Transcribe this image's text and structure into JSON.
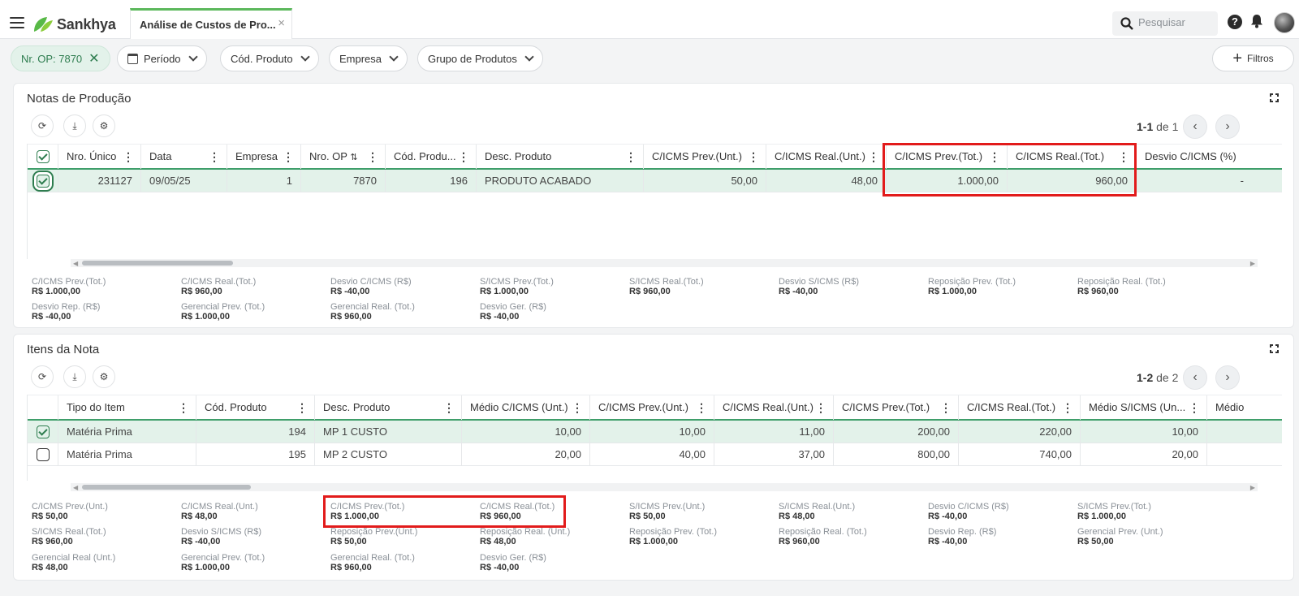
{
  "app": {
    "brand": "Sankhya",
    "tab_title": "Análise de Custos de Pro...",
    "tab_close": "×"
  },
  "search": {
    "placeholder": "Pesquisar"
  },
  "header_icons": {
    "help": "?"
  },
  "filters": [
    {
      "label": "Nr. OP: 7870",
      "active": true
    },
    {
      "label": "Período"
    },
    {
      "label": "Cód. Produto"
    },
    {
      "label": "Empresa"
    },
    {
      "label": "Grupo de Produtos"
    }
  ],
  "filtros_button": "Filtros",
  "notas": {
    "title": "Notas de Produção",
    "pager": {
      "range": "1-1",
      "of": "de 1"
    },
    "columns": [
      "Nro. Único",
      "Data",
      "Empresa",
      "Nro. OP",
      "Cód. Produ...",
      "Desc. Produto",
      "C/ICMS Prev.(Unt.)",
      "C/ICMS Real.(Unt.)",
      "C/ICMS Prev.(Tot.)",
      "C/ICMS Real.(Tot.)",
      "Desvio C/ICMS (%)"
    ],
    "rows": [
      [
        "231127",
        "09/05/25",
        "1",
        "7870",
        "196",
        "PRODUTO ACABADO",
        "50,00",
        "48,00",
        "1.000,00",
        "960,00",
        "-"
      ]
    ],
    "totals": [
      {
        "label": "C/ICMS Prev.(Tot.)",
        "value": "R$ 1.000,00"
      },
      {
        "label": "C/ICMS Real.(Tot.)",
        "value": "R$ 960,00"
      },
      {
        "label": "Desvio C/ICMS (R$)",
        "value": "R$ -40,00"
      },
      {
        "label": "S/ICMS Prev.(Tot.)",
        "value": "R$ 1.000,00"
      },
      {
        "label": "S/ICMS Real.(Tot.)",
        "value": "R$ 960,00"
      },
      {
        "label": "Desvio S/ICMS (R$)",
        "value": "R$ -40,00"
      },
      {
        "label": "Reposição Prev. (Tot.)",
        "value": "R$ 1.000,00"
      },
      {
        "label": "Reposição Real. (Tot.)",
        "value": "R$ 960,00"
      },
      {
        "label": "Desvio Rep. (R$)",
        "value": "R$ -40,00"
      },
      {
        "label": "Gerencial Prev. (Tot.)",
        "value": "R$ 1.000,00"
      },
      {
        "label": "Gerencial Real. (Tot.)",
        "value": "R$ 960,00"
      },
      {
        "label": "Desvio Ger. (R$)",
        "value": "R$ -40,00"
      }
    ]
  },
  "itens": {
    "title": "Itens da Nota",
    "pager": {
      "range": "1-2",
      "of": "de 2"
    },
    "columns": [
      "Tipo do Item",
      "Cód. Produto",
      "Desc. Produto",
      "Médio C/ICMS (Unt.)",
      "C/ICMS Prev.(Unt.)",
      "C/ICMS Real.(Unt.)",
      "C/ICMS Prev.(Tot.)",
      "C/ICMS Real.(Tot.)",
      "Médio S/ICMS (Un...",
      "Médio"
    ],
    "rows": [
      [
        "Matéria Prima",
        "194",
        "MP 1 CUSTO",
        "10,00",
        "10,00",
        "11,00",
        "200,00",
        "220,00",
        "10,00",
        ""
      ],
      [
        "Matéria Prima",
        "195",
        "MP 2 CUSTO",
        "20,00",
        "40,00",
        "37,00",
        "800,00",
        "740,00",
        "20,00",
        ""
      ]
    ],
    "totals": [
      {
        "label": "C/ICMS Prev.(Unt.)",
        "value": "R$ 50,00"
      },
      {
        "label": "C/ICMS Real.(Unt.)",
        "value": "R$ 48,00"
      },
      {
        "label": "C/ICMS Prev.(Tot.)",
        "value": "R$ 1.000,00"
      },
      {
        "label": "C/ICMS Real.(Tot.)",
        "value": "R$ 960,00"
      },
      {
        "label": "S/ICMS Prev.(Unt.)",
        "value": "R$ 50,00"
      },
      {
        "label": "S/ICMS Real.(Unt.)",
        "value": "R$ 48,00"
      },
      {
        "label": "Desvio C/ICMS (R$)",
        "value": "R$ -40,00"
      },
      {
        "label": "S/ICMS Prev.(Tot.)",
        "value": "R$ 1.000,00"
      },
      {
        "label": "S/ICMS Real.(Tot.)",
        "value": "R$ 960,00"
      },
      {
        "label": "Desvio S/ICMS (R$)",
        "value": "R$ -40,00"
      },
      {
        "label": "Reposição Prev.(Unt.)",
        "value": "R$ 50,00"
      },
      {
        "label": "Reposição Real. (Unt.)",
        "value": "R$ 48,00"
      },
      {
        "label": "Reposição Prev. (Tot.)",
        "value": "R$ 1.000,00"
      },
      {
        "label": "Reposição Real. (Tot.)",
        "value": "R$ 960,00"
      },
      {
        "label": "Desvio Rep. (R$)",
        "value": "R$ -40,00"
      },
      {
        "label": "Gerencial Prev. (Unt.)",
        "value": "R$ 50,00"
      },
      {
        "label": "Gerencial Real (Unt.)",
        "value": "R$ 48,00"
      },
      {
        "label": "Gerencial Prev. (Tot.)",
        "value": "R$ 1.000,00"
      },
      {
        "label": "Gerencial Real. (Tot.)",
        "value": "R$ 960,00"
      },
      {
        "label": "Desvio Ger. (R$)",
        "value": "R$ -40,00"
      }
    ]
  },
  "colors": {
    "accent": "#3f9e6a",
    "selected_row": "#e3f2ea",
    "highlight": "#e21b1b"
  }
}
